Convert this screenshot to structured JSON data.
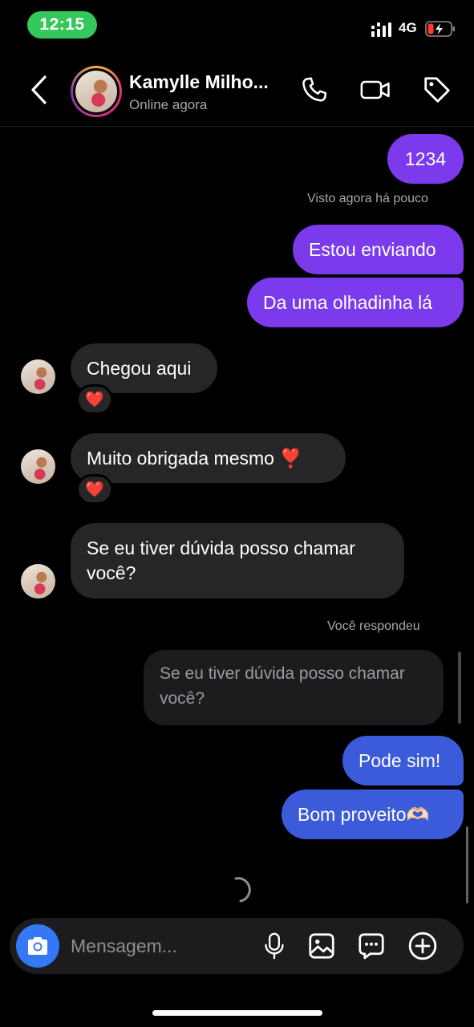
{
  "status_bar": {
    "time": "12:15",
    "network": "4G"
  },
  "header": {
    "contact_name": "Kamylle Milho...",
    "contact_status": "Online agora",
    "icons": [
      "back-icon",
      "phone-icon",
      "video-camera-icon",
      "tag-icon"
    ]
  },
  "messages": {
    "m1": "1234",
    "seen": "Visto agora há pouco",
    "m2": "Estou enviando",
    "m3": "Da uma olhadinha lá",
    "r1": "Chegou aqui",
    "r1_reaction": "❤️",
    "r2": "Muito obrigada mesmo ❣️",
    "r2_reaction": "❤️",
    "r3_line1": "Se eu tiver dúvida posso chamar",
    "r3_line2": "você?",
    "reply_label": "Você respondeu",
    "quote_line1": "Se eu tiver dúvida posso chamar",
    "quote_line2": "você?",
    "m4": "Pode sim!",
    "m5": "Bom proveito🫶🏻"
  },
  "composer": {
    "placeholder": "Mensagem...",
    "icons": [
      "camera-icon",
      "microphone-icon",
      "gallery-icon",
      "sticker-icon",
      "add-icon"
    ]
  },
  "colors": {
    "sent_purple": "#7c3aed",
    "sent_blue": "#3b5bdb",
    "received": "#262628",
    "status_green": "#34c759",
    "camera_blue": "#3478f6"
  }
}
